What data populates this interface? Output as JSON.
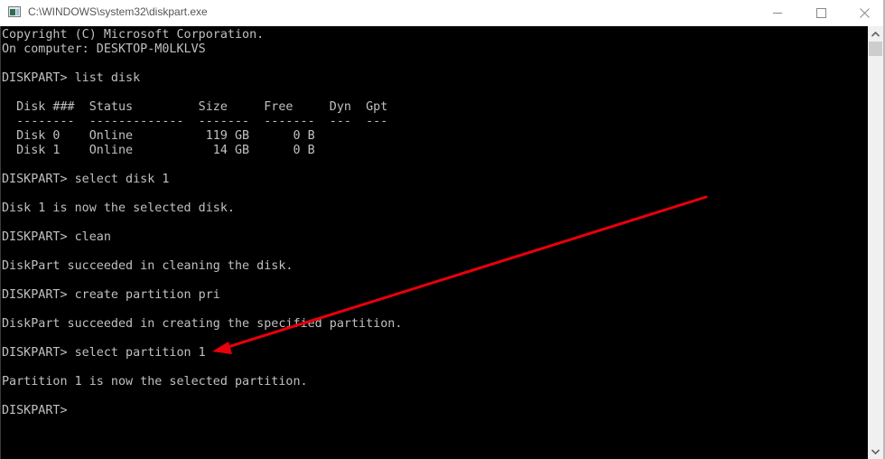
{
  "window": {
    "title": "C:\\WINDOWS\\system32\\diskpart.exe",
    "icon": "console-app-icon",
    "controls": [
      "minimize",
      "maximize",
      "close"
    ]
  },
  "console": {
    "lines": [
      "Copyright (C) Microsoft Corporation.",
      "On computer: DESKTOP-M0LKLVS",
      "",
      "DISKPART> list disk",
      "",
      "  Disk ###  Status         Size     Free     Dyn  Gpt",
      "  --------  -------------  -------  -------  ---  ---",
      "  Disk 0    Online          119 GB      0 B",
      "  Disk 1    Online           14 GB      0 B",
      "",
      "DISKPART> select disk 1",
      "",
      "Disk 1 is now the selected disk.",
      "",
      "DISKPART> clean",
      "",
      "DiskPart succeeded in cleaning the disk.",
      "",
      "DISKPART> create partition pri",
      "",
      "DiskPart succeeded in creating the specified partition.",
      "",
      "DISKPART> select partition 1",
      "",
      "Partition 1 is now the selected partition.",
      "",
      "DISKPART>"
    ]
  },
  "annotation": {
    "type": "arrow",
    "color": "#e8000b",
    "points_to": "DISKPART> select partition 1"
  },
  "colors": {
    "console_bg": "#000000",
    "console_fg": "#c0c0c0",
    "titlebar_bg": "#ffffff"
  }
}
